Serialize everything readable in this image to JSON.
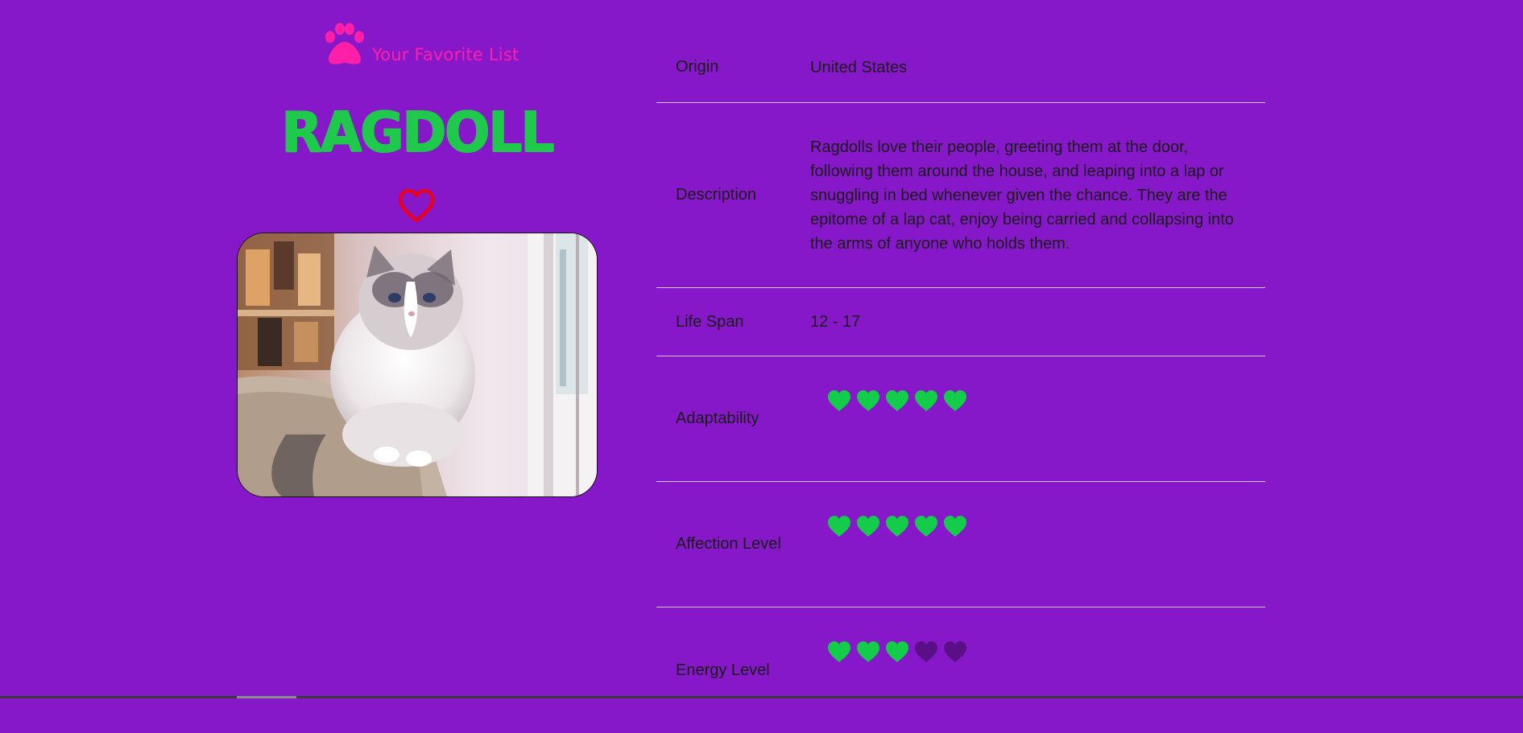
{
  "header": {
    "favorite_link": "Your Favorite List",
    "paw_icon": "paw-icon"
  },
  "breed": {
    "name": "RAGDOLL",
    "favorite_icon": "heart-outline-icon",
    "photo_alt": "Ragdoll cat"
  },
  "colors": {
    "background": "#8718c9",
    "accent_pink": "#ff1fa8",
    "title_green": "#1fc94b",
    "heart_red": "#e8001c",
    "rating_filled": "#12cc4a",
    "rating_empty": "#5a0f86"
  },
  "details": {
    "origin": {
      "label": "Origin",
      "value": "United States"
    },
    "description": {
      "label": "Description",
      "value": "Ragdolls love their people, greeting them at the door, following them around the house, and leaping into a lap or snuggling in bed whenever given the chance. They are the epitome of a lap cat, enjoy being carried and collapsing into the arms of anyone who holds them."
    },
    "life_span": {
      "label": "Life Span",
      "value": "12 - 17"
    },
    "adaptability": {
      "label": "Adaptability",
      "rating": 5,
      "max": 5
    },
    "affection_level": {
      "label": "Affection Level",
      "rating": 5,
      "max": 5
    },
    "energy_level": {
      "label": "Energy Level",
      "rating": 3,
      "max": 5
    }
  }
}
